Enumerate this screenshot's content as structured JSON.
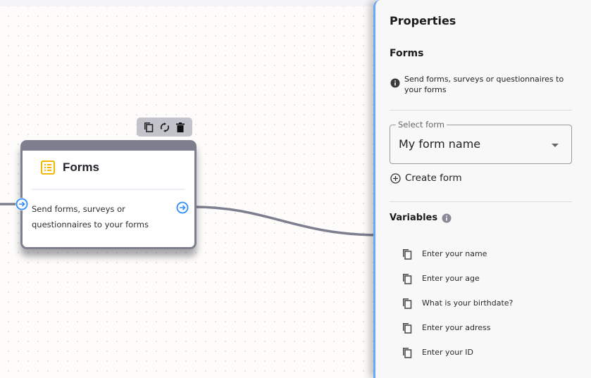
{
  "canvas": {
    "node": {
      "title": "Forms",
      "description": "Send forms, surveys or questionnaires to your forms",
      "icon": "form-list-icon",
      "toolbar": [
        {
          "name": "duplicate",
          "icon": "copy-icon"
        },
        {
          "name": "replace",
          "icon": "refresh-icon"
        },
        {
          "name": "delete",
          "icon": "trash-icon"
        }
      ]
    }
  },
  "panel": {
    "title": "Properties",
    "section_title": "Forms",
    "info_text": "Send forms, surveys or questionnaires to your forms",
    "select": {
      "label": "Select form",
      "value": "My form name"
    },
    "create_form_label": "Create form",
    "variables_title": "Variables",
    "variables": [
      {
        "label": "Enter your name"
      },
      {
        "label": "Enter your age"
      },
      {
        "label": "What is your birthdate?"
      },
      {
        "label": "Enter your adress"
      },
      {
        "label": "Enter your ID"
      }
    ]
  },
  "colors": {
    "accent": "#2f8cff",
    "panel_border": "#68a9ff",
    "node_frame": "#7d7f8f",
    "icon_yellow": "#f5b800",
    "edge": "#7d7f8f"
  }
}
